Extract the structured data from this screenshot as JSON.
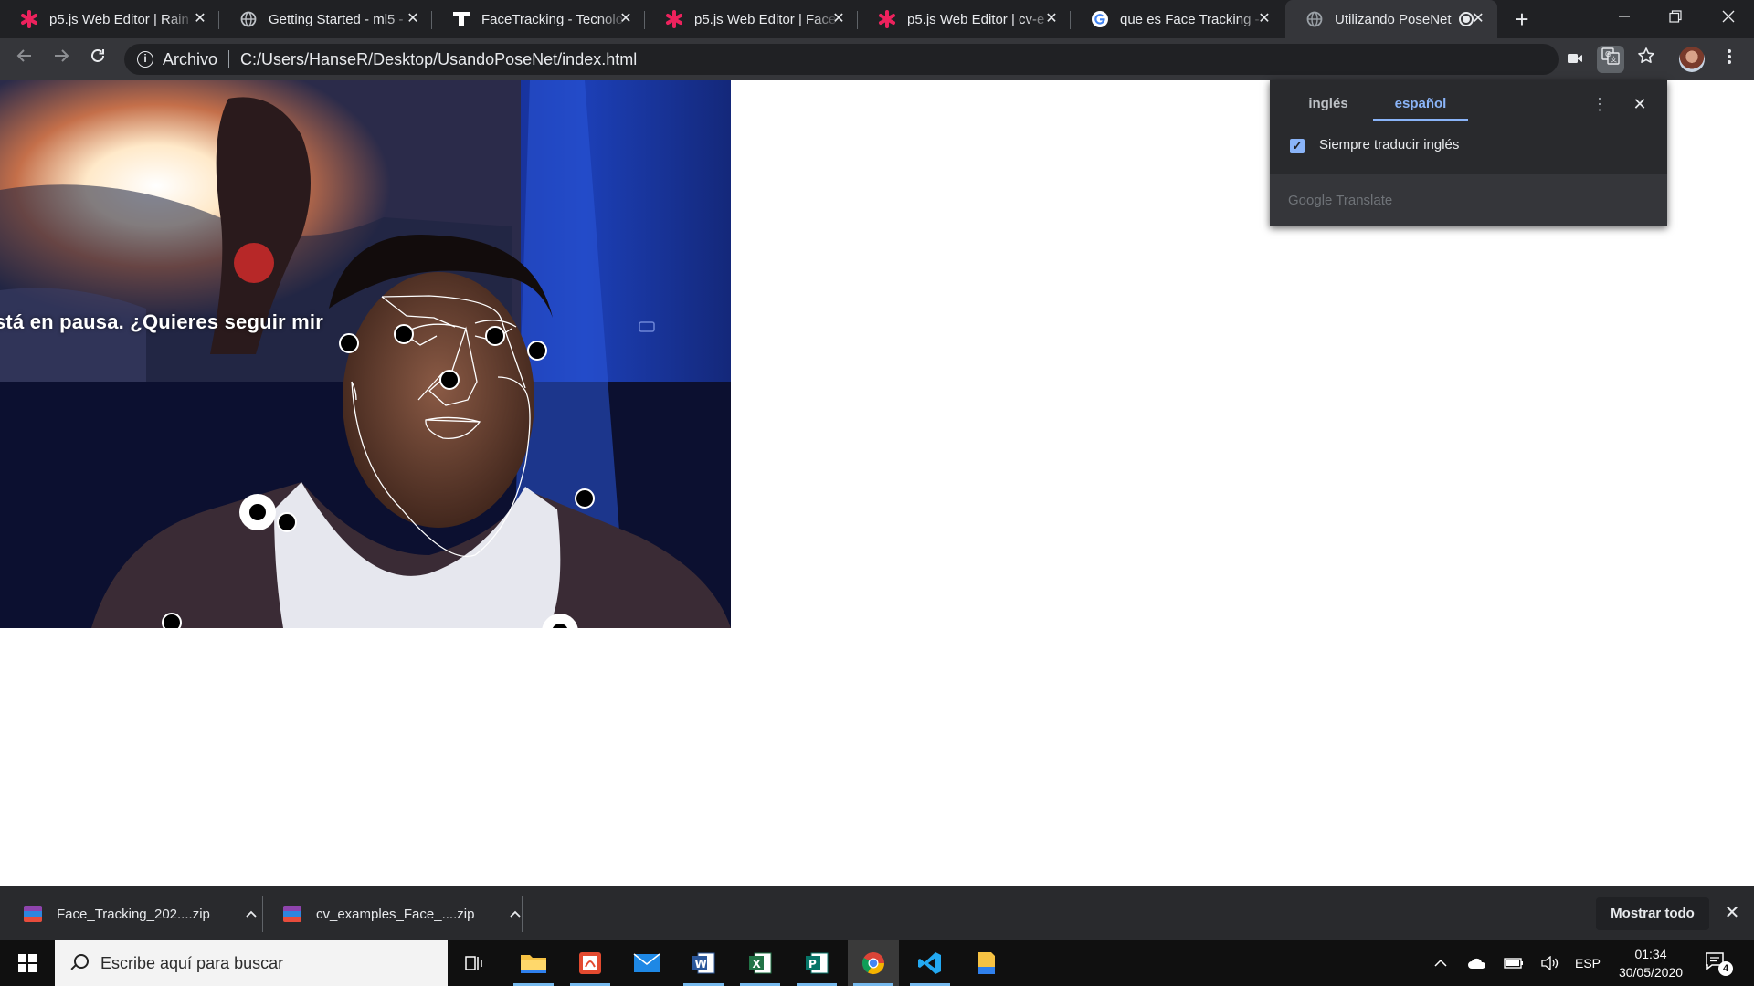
{
  "browser": {
    "tabs": [
      {
        "title": "p5.js Web Editor | Rain",
        "icon": "p5-asterisk-icon",
        "active": false
      },
      {
        "title": "Getting Started - ml5 -",
        "icon": "globe-icon",
        "active": false
      },
      {
        "title": "FaceTracking - Tecnolo",
        "icon": "cross-logo-icon",
        "active": false
      },
      {
        "title": "p5.js Web Editor | Face",
        "icon": "p5-asterisk-icon",
        "active": false
      },
      {
        "title": "p5.js Web Editor | cv-e",
        "icon": "p5-asterisk-icon",
        "active": false
      },
      {
        "title": "que es Face Tracking -",
        "icon": "google-g-icon",
        "active": false
      },
      {
        "title": "Utilizando PoseNet",
        "icon": "globe-icon",
        "active": true
      }
    ],
    "close_glyph": "✕",
    "new_tab_glyph": "+",
    "address": {
      "scheme_label": "Archivo",
      "url": "C:/Users/HanseR/Desktop/UsandoPoseNet/index.html"
    }
  },
  "page": {
    "video_overlay_text": "stá en pausa. ¿Quieres seguir mir"
  },
  "translate_bubble": {
    "source_lang": "inglés",
    "target_lang": "español",
    "active_tab": "español",
    "always_translate_label": "Siempre traducir inglés",
    "always_translate_checked": true,
    "footer": "Google Translate"
  },
  "downloads": {
    "items": [
      {
        "filename": "Face_Tracking_202....zip"
      },
      {
        "filename": "cv_examples_Face_....zip"
      }
    ],
    "show_all_label": "Mostrar todo"
  },
  "taskbar": {
    "search_placeholder": "Escribe aquí para buscar",
    "language": "ESP",
    "time": "01:34",
    "date": "30/05/2020",
    "notification_count": "4"
  }
}
